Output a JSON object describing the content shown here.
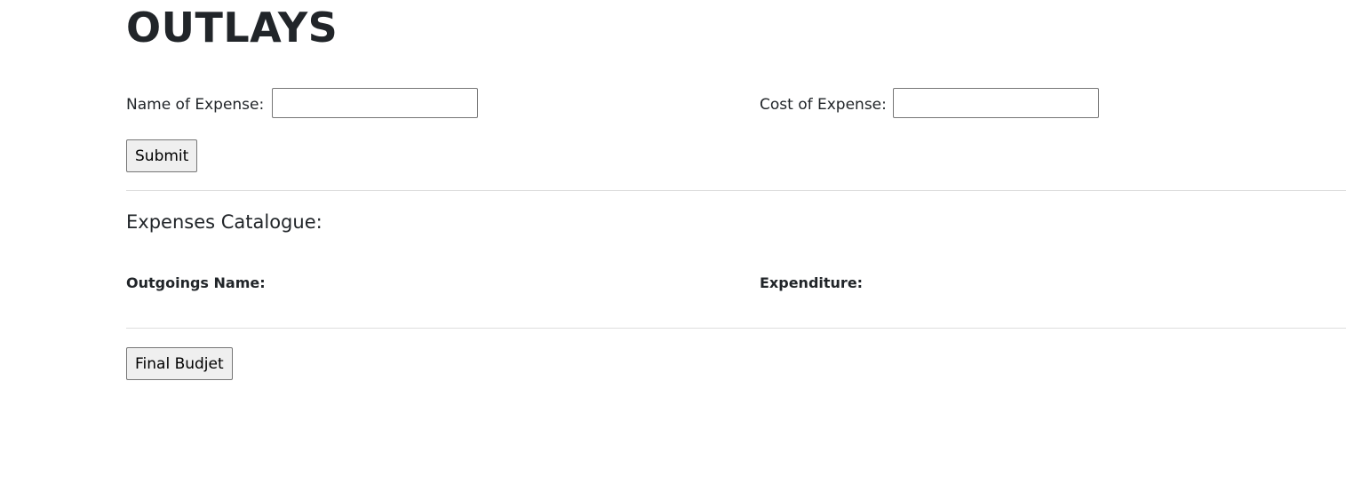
{
  "title": "OUTLAYS",
  "form": {
    "name_label": "Name of Expense:",
    "name_value": "",
    "cost_label": "Cost of Expense:",
    "cost_value": "",
    "submit_label": "Submit"
  },
  "catalogue": {
    "heading": "Expenses Catalogue:",
    "col_name": "Outgoings Name:",
    "col_cost": "Expenditure:"
  },
  "final_button_label": "Final Budjet"
}
